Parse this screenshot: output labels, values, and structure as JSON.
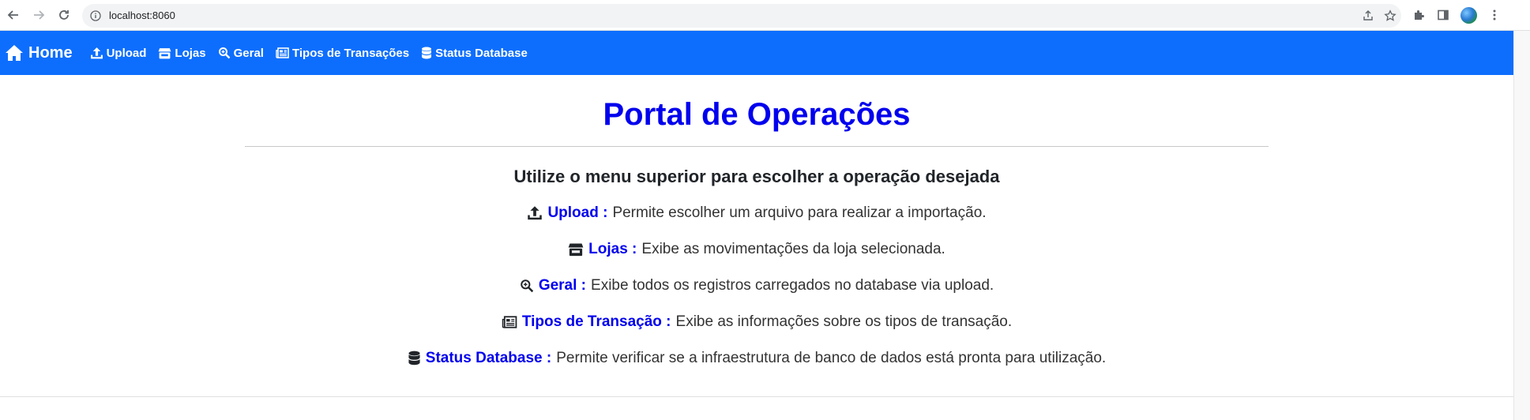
{
  "browser": {
    "url": "localhost:8060"
  },
  "navbar": {
    "brand": "Home",
    "items": [
      {
        "label": "Upload",
        "icon": "upload-icon"
      },
      {
        "label": "Lojas",
        "icon": "store-icon"
      },
      {
        "label": "Geral",
        "icon": "search-icon"
      },
      {
        "label": "Tipos de Transações",
        "icon": "newspaper-icon"
      },
      {
        "label": "Status Database",
        "icon": "database-icon"
      }
    ],
    "color": "#0d6efd"
  },
  "main": {
    "title": "Portal de Operações",
    "subtitle": "Utilize o menu superior para escolher a operação desejada",
    "descriptions": [
      {
        "name": "Upload :",
        "text": "Permite escolher um arquivo para realizar a importação.",
        "icon": "upload-icon"
      },
      {
        "name": "Lojas :",
        "text": "Exibe as movimentações da loja selecionada.",
        "icon": "store-icon"
      },
      {
        "name": "Geral :",
        "text": "Exibe todos os registros carregados no database via upload.",
        "icon": "search-icon"
      },
      {
        "name": "Tipos de Transação :",
        "text": "Exibe as informações sobre os tipos de transação.",
        "icon": "newspaper-icon"
      },
      {
        "name": "Status Database :",
        "text": "Permite verificar se a infraestrutura de banco de dados está pronta para utilização.",
        "icon": "database-icon"
      }
    ],
    "title_color": "#0000ee"
  }
}
